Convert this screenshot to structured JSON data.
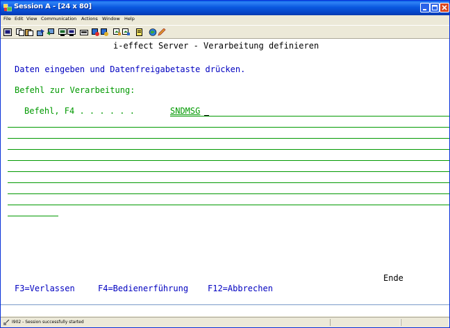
{
  "window": {
    "title": "Session A - [24 x 80]"
  },
  "menu": [
    "File",
    "Edit",
    "View",
    "Communication",
    "Actions",
    "Window",
    "Help"
  ],
  "screen": {
    "header": "i-effect Server - Verarbeitung definieren",
    "instruction": "Daten eingeben und Datenfreigabetaste drücken.",
    "section": "Befehl zur Verarbeitung:",
    "field_label": "Befehl, F4 . . . . . . ",
    "field_value": "SNDMSG",
    "ende": "Ende",
    "fkeys": {
      "f3": "F3=Verlassen",
      "f4": "F4=Bedienerführung",
      "f12": "F12=Abbrechen"
    }
  },
  "status": {
    "text": "I902 - Session successfully started"
  },
  "colors": {
    "screen_text_blue": "#0000c0",
    "screen_text_green": "#009900",
    "title_bar": "#0a58e0"
  },
  "toolbar_icons": [
    "print-screen-icon",
    "copy-icon",
    "paste-icon",
    "send-icon",
    "receive-icon",
    "display-icon",
    "keyboard-icon",
    "macro-record-icon",
    "macro-stop-icon",
    "macro-play-icon",
    "customize-icon",
    "clipboard-icon",
    "globe-icon",
    "edit-icon"
  ]
}
